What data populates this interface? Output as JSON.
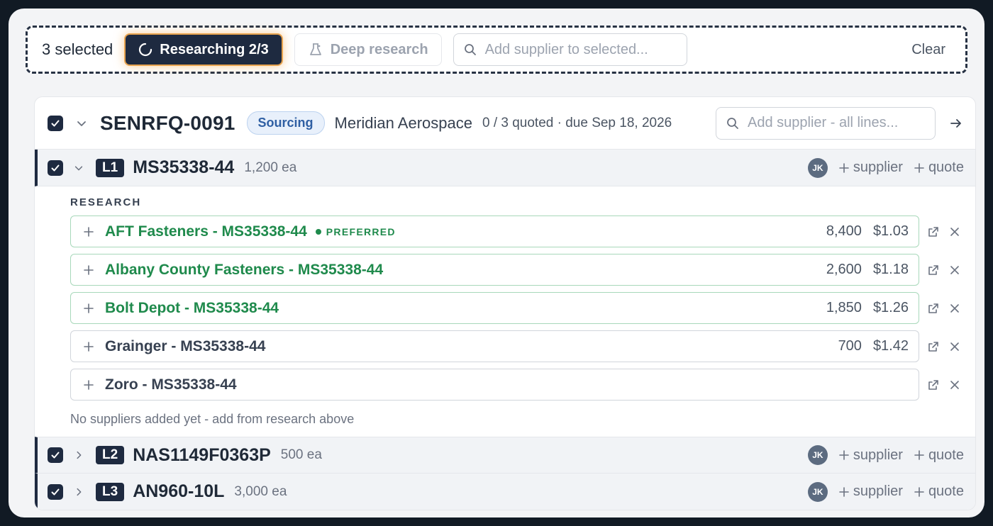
{
  "selection": {
    "count_label": "3 selected",
    "researching_label": "Researching 2/3",
    "deep_research_label": "Deep research",
    "add_supplier_placeholder": "Add supplier to selected...",
    "clear_label": "Clear"
  },
  "rfq": {
    "id": "SENRFQ-0091",
    "status": "Sourcing",
    "customer": "Meridian Aerospace",
    "quoted_summary": "0 / 3 quoted · due Sep 18, 2026",
    "search_placeholder": "Add supplier - all lines..."
  },
  "lines": [
    {
      "tag": "L1",
      "part": "MS35338-44",
      "qty": "1,200 ea",
      "assignee": "JK",
      "add_supplier": "supplier",
      "add_quote": "quote",
      "expanded": true
    },
    {
      "tag": "L2",
      "part": "NAS1149F0363P",
      "qty": "500 ea",
      "assignee": "JK",
      "add_supplier": "supplier",
      "add_quote": "quote",
      "expanded": false
    },
    {
      "tag": "L3",
      "part": "AN960-10L",
      "qty": "3,000 ea",
      "assignee": "JK",
      "add_supplier": "supplier",
      "add_quote": "quote",
      "expanded": false
    }
  ],
  "research": {
    "heading": "RESEARCH",
    "results": [
      {
        "name": "AFT Fasteners - MS35338-44",
        "badge": "PREFERRED",
        "stock": "8,400",
        "price": "$1.03",
        "highlight": true
      },
      {
        "name": "Albany County Fasteners - MS35338-44",
        "badge": "",
        "stock": "2,600",
        "price": "$1.18",
        "highlight": true
      },
      {
        "name": "Bolt Depot - MS35338-44",
        "badge": "",
        "stock": "1,850",
        "price": "$1.26",
        "highlight": true
      },
      {
        "name": "Grainger - MS35338-44",
        "badge": "",
        "stock": "700",
        "price": "$1.42",
        "highlight": false
      },
      {
        "name": "Zoro - MS35338-44",
        "badge": "",
        "stock": "",
        "price": "",
        "highlight": false
      }
    ],
    "empty_note": "No suppliers added yet - add from research above"
  },
  "colors": {
    "navy": "#1e2a40",
    "green": "#1f8a4c",
    "badge_blue": "#2f5fa3",
    "orange_glow": "#e8a34e"
  }
}
